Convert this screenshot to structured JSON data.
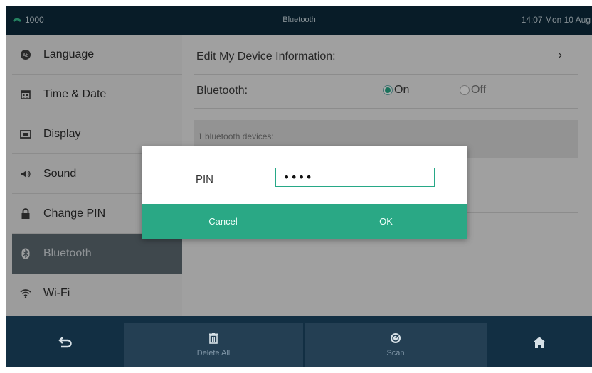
{
  "status_bar": {
    "line": "1000",
    "title": "Bluetooth",
    "datetime": "14:07 Mon 10 Aug",
    "icon": "phone-icon"
  },
  "sidebar": {
    "items": [
      {
        "label": "Language",
        "icon": "language-icon"
      },
      {
        "label": "Time & Date",
        "icon": "calendar-icon"
      },
      {
        "label": "Display",
        "icon": "display-icon"
      },
      {
        "label": "Sound",
        "icon": "speaker-icon"
      },
      {
        "label": "Change PIN",
        "icon": "lock-icon"
      },
      {
        "label": "Bluetooth",
        "icon": "bluetooth-icon",
        "active": true
      },
      {
        "label": "Wi-Fi",
        "icon": "wifi-icon"
      }
    ]
  },
  "content": {
    "edit_device_label": "Edit My Device Information:",
    "bluetooth_label": "Bluetooth:",
    "option_on": "On",
    "option_off": "Off",
    "selected": "On",
    "devices_text": "1 bluetooth devices:"
  },
  "dialog": {
    "pin_label": "PIN",
    "pin_value": "••••",
    "cancel_label": "Cancel",
    "ok_label": "OK"
  },
  "bottom_bar": {
    "back_icon": "back-icon",
    "delete_all_label": "Delete All",
    "scan_label": "Scan",
    "home_icon": "home-icon"
  },
  "colors": {
    "accent": "#2aa885",
    "status_bar": "#0d2a3b",
    "active_item": "#5e6a72"
  }
}
